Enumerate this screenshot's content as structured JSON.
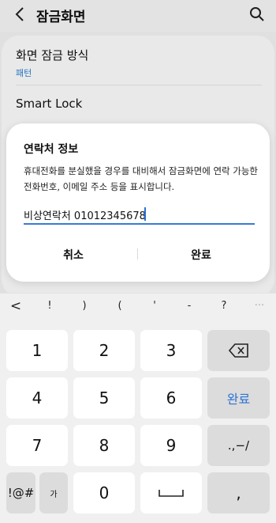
{
  "app_bar": {
    "title": "잠금화면"
  },
  "settings": {
    "lock_type_label": "화면 잠금 방식",
    "lock_type_value": "패턴",
    "smart_lock": "Smart Lock"
  },
  "dialog": {
    "title": "연락처 정보",
    "description": "휴대전화를 분실했을 경우를 대비해서 잠금화면에 연락 가능한 전화번호, 이메일 주소 등을 표시합니다.",
    "input_value": "비상연락처 01012345678",
    "cancel_label": "취소",
    "done_label": "완료"
  },
  "keyboard": {
    "symbols": [
      "<",
      "!",
      ")",
      "(",
      "'",
      "-",
      "?",
      "···"
    ],
    "rows": [
      [
        "1",
        "2",
        "3",
        "⌫"
      ],
      [
        "4",
        "5",
        "6",
        "완료"
      ],
      [
        "7",
        "8",
        "9",
        ".,−/"
      ],
      [
        "!@#",
        "가",
        "0",
        "␣",
        ","
      ]
    ]
  }
}
